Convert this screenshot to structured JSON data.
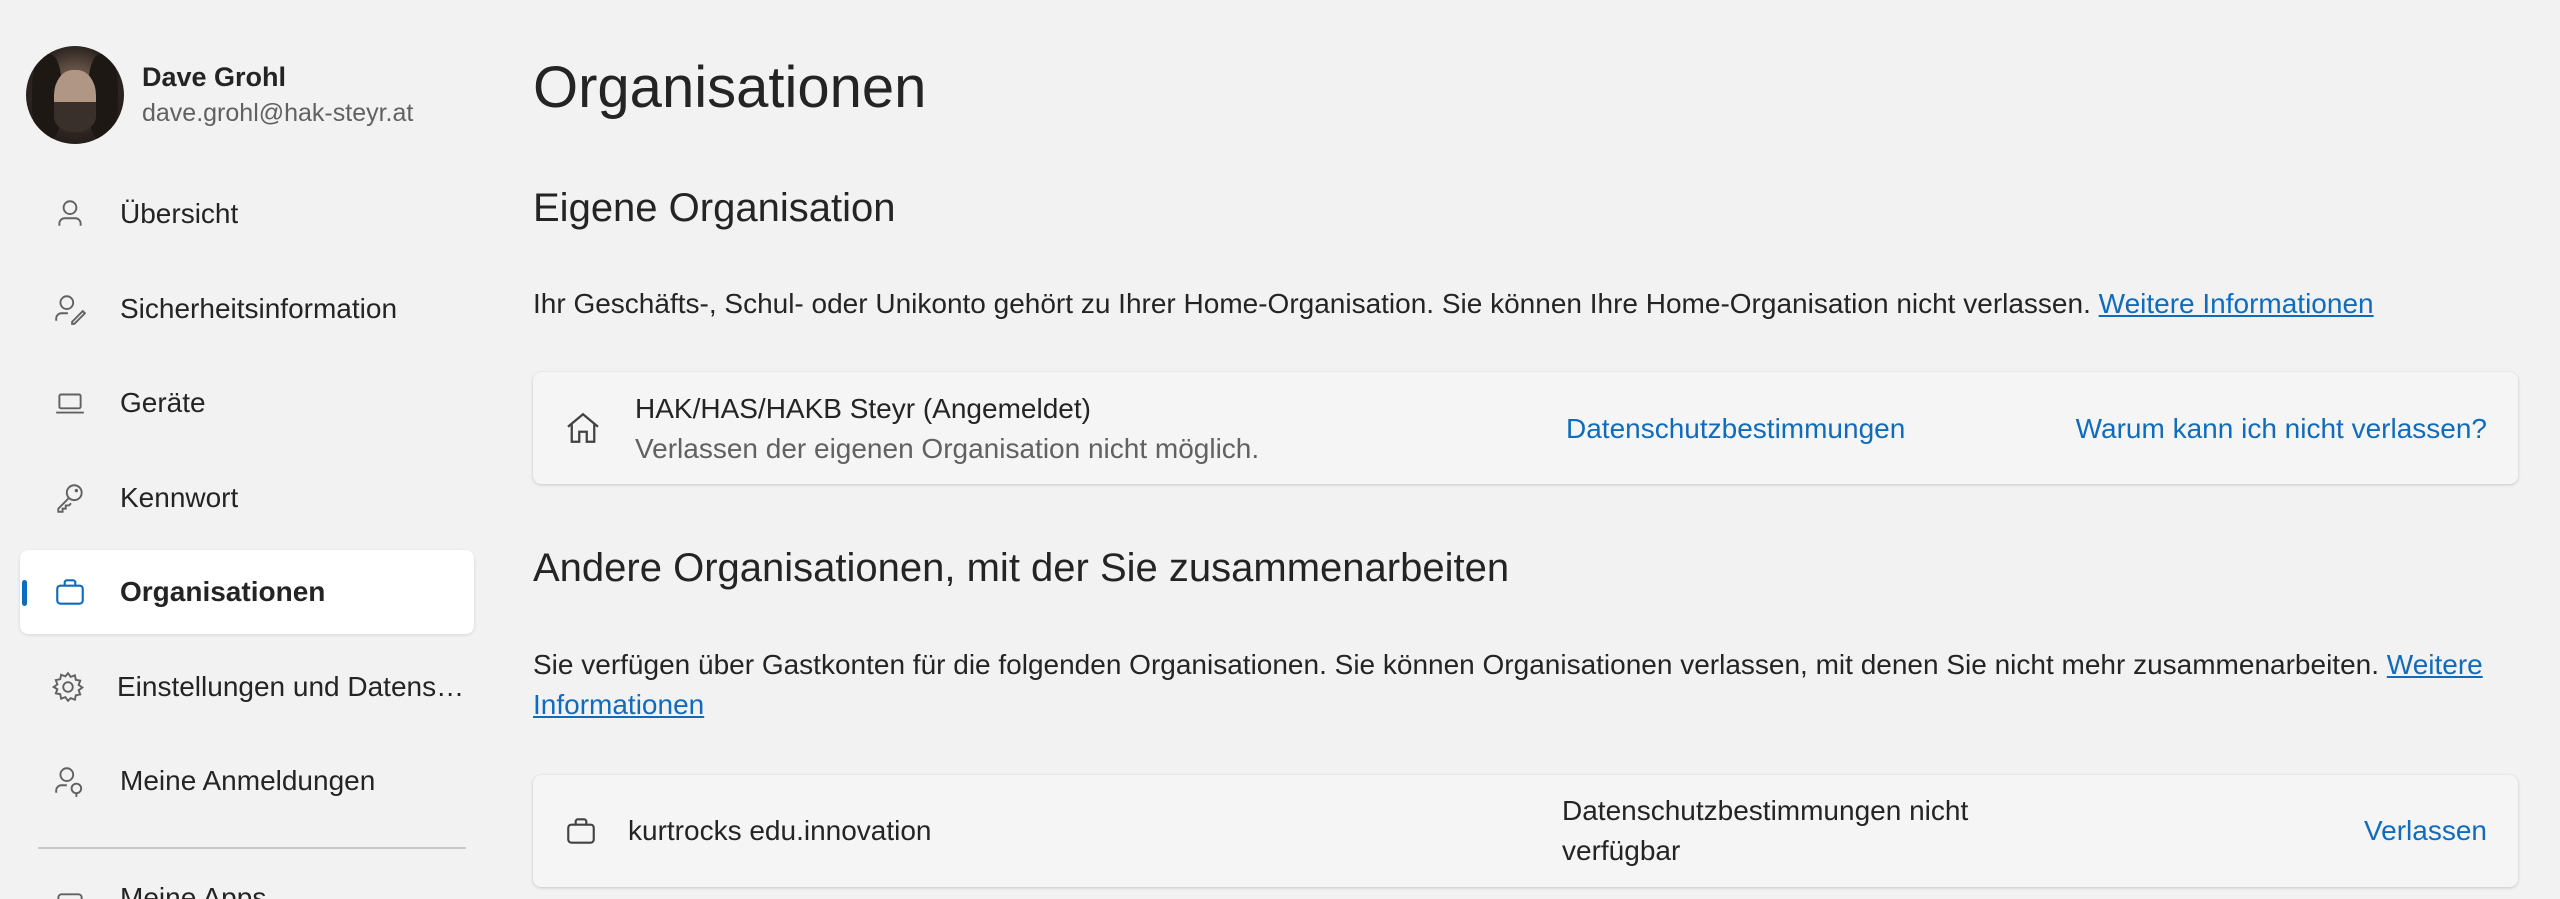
{
  "profile": {
    "name": "Dave Grohl",
    "email": "dave.grohl@hak-steyr.at"
  },
  "sidebar": {
    "items": [
      {
        "label": "Übersicht",
        "icon": "person-icon"
      },
      {
        "label": "Sicherheitsinformation",
        "icon": "person-key-icon"
      },
      {
        "label": "Geräte",
        "icon": "laptop-icon"
      },
      {
        "label": "Kennwort",
        "icon": "key-icon"
      },
      {
        "label": "Organisationen",
        "icon": "briefcase-icon",
        "active": true
      },
      {
        "label": "Einstellungen und Datenschutz",
        "icon": "gear-icon"
      },
      {
        "label": "Meine Anmeldungen",
        "icon": "person-lock-icon"
      }
    ],
    "more_label": "Meine Apps"
  },
  "main": {
    "title": "Organisationen",
    "own": {
      "heading": "Eigene Organisation",
      "description": "Ihr Geschäfts-, Schul- oder Unikonto gehört zu Ihrer Home-Organisation. Sie können Ihre Home-Organisation nicht verlassen.",
      "more_info": "Weitere Informationen",
      "card": {
        "name": "HAK/HAS/HAKB Steyr (Angemeldet)",
        "status": "Verlassen der eigenen Organisation nicht möglich.",
        "privacy": "Datenschutzbestimmungen",
        "why": "Warum kann ich nicht verlassen?"
      }
    },
    "other": {
      "heading": "Andere Organisationen, mit der Sie zusammenarbeiten",
      "description": "Sie verfügen über Gastkonten für die folgenden Organisationen. Sie können Organisationen verlassen, mit denen Sie nicht mehr zusammenarbeiten.",
      "more_info": "Weitere Informationen",
      "card": {
        "name": "kurtrocks edu.innovation",
        "privacy": "Datenschutzbestimmungen nicht verfügbar",
        "leave": "Verlassen"
      }
    }
  },
  "colors": {
    "accent": "#0f6cbd",
    "background": "#f2f2f2",
    "text": "#242424",
    "secondary_text": "#616161"
  }
}
